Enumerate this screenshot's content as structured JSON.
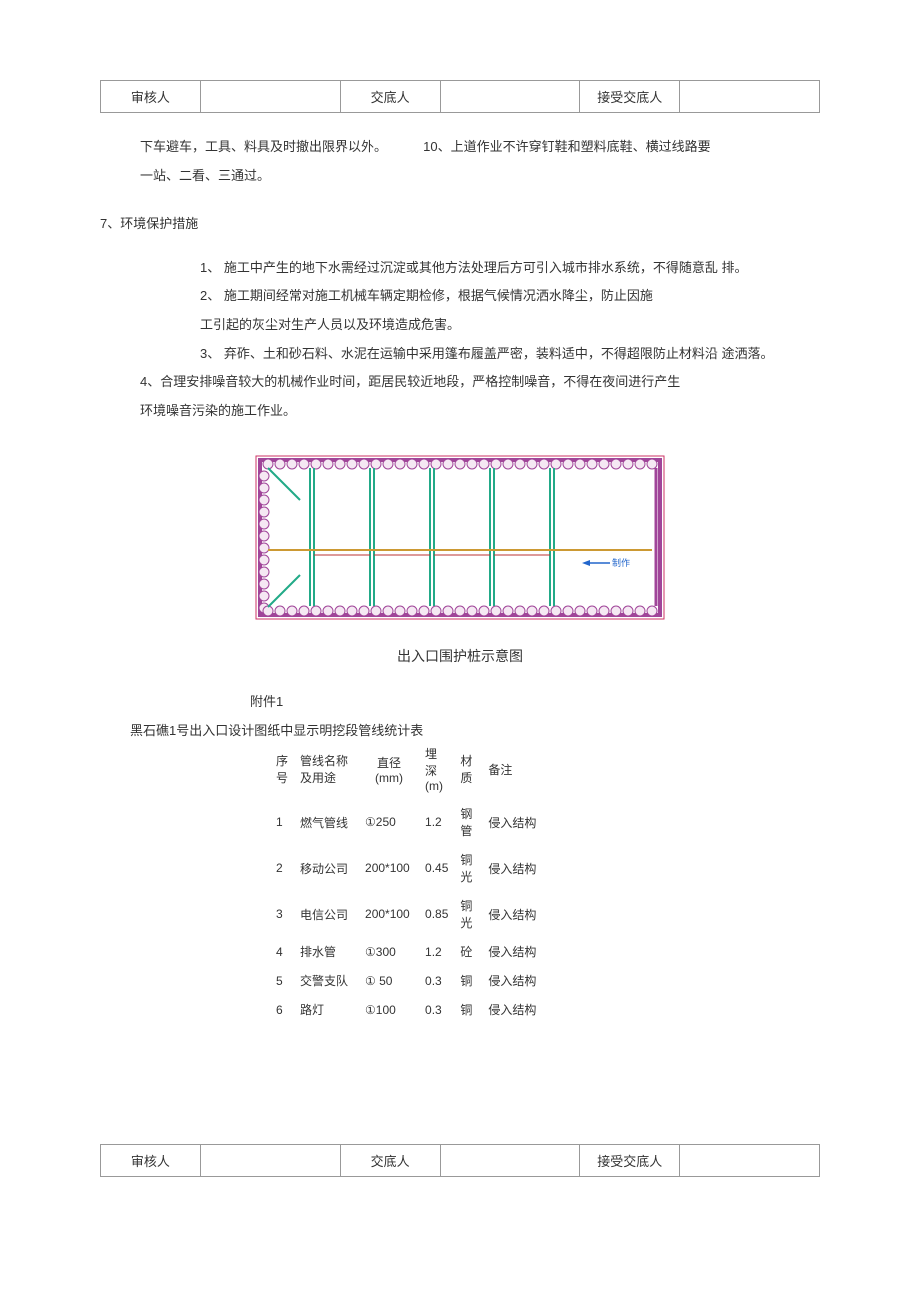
{
  "signoff": {
    "reviewer_label": "审核人",
    "handover_label": "交底人",
    "receiver_label": "接受交底人"
  },
  "paragraphs": {
    "p1_a": "下车避车，工具、料具及时撤出限界以外。",
    "p1_b": "10、上道作业不许穿钉鞋和塑料底鞋、横过线路要",
    "p2": "一站、二看、三通过。",
    "section7": "7、环境保护措施",
    "env1": "1、 施工中产生的地下水需经过沉淀或其他方法处理后方可引入城市排水系统，不得随意乱 排。",
    "env2": "2、 施工期间经常对施工机械车辆定期检修，根据气候情况洒水降尘，防止因施",
    "env3": "工引起的灰尘对生产人员以及环境造成危害。",
    "env4": "3、 弃砟、土和砂石料、水泥在运输中采用篷布履盖严密，装料适中，不得超限防止材料沿  途洒落。",
    "env5": "4、合理安排噪音较大的机械作业时间，距居民较近地段，严格控制噪音，不得在夜间进行产生",
    "env6": "环境噪音污染的施工作业。"
  },
  "diagram_caption": "出入口围护桩示意图",
  "diagram_label": "制作",
  "attachment_label": "附件1",
  "table_title": "黑石礁1号出入口设计图纸中显示明挖段管线统计表",
  "table_headers": {
    "seq": "序号",
    "name": "管线名称及用途",
    "diam": "直径(mm)",
    "depth": "埋深(m)",
    "material": "材质",
    "note": "备注"
  },
  "pipelines": [
    {
      "seq": "1",
      "name": "燃气管线",
      "diam": "①250",
      "depth": "1.2",
      "material": "钢管",
      "note": "侵入结构"
    },
    {
      "seq": "2",
      "name": "移动公司",
      "diam": "200*100",
      "depth": "0.45",
      "material": "铜光",
      "note": "侵入结构"
    },
    {
      "seq": "3",
      "name": "电信公司",
      "diam": "200*100",
      "depth": "0.85",
      "material": "铜光",
      "note": "侵入结构"
    },
    {
      "seq": "4",
      "name": "排水管",
      "diam": "①300",
      "depth": "1.2",
      "material": "砼",
      "note": "侵入结构"
    },
    {
      "seq": "5",
      "name": "交警支队",
      "diam": "① 50",
      "depth": "0.3",
      "material": "铜",
      "note": "侵入结构"
    },
    {
      "seq": "6",
      "name": "路灯",
      "diam": "①100",
      "depth": "0.3",
      "material": "铜",
      "note": "侵入结构"
    }
  ]
}
